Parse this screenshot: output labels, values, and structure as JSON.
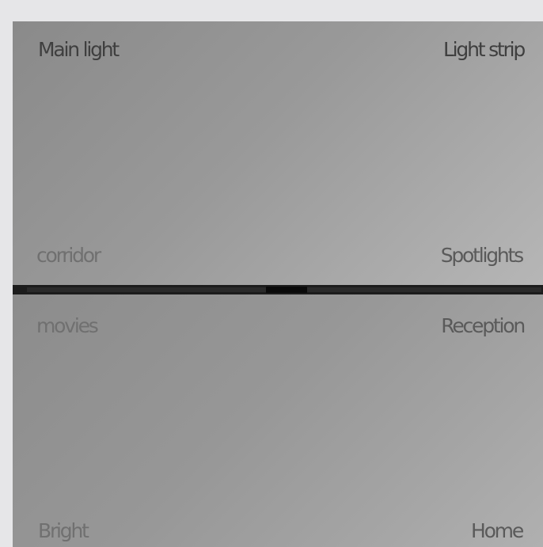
{
  "scenes": {
    "main_light": "Main light",
    "light_strip": "Light strip",
    "corridor": "corridor",
    "spotlights": "Spotlights",
    "movies": "movies",
    "reception": "Reception",
    "bright": "Bright",
    "home": "Home"
  },
  "colors": {
    "background": "#e6e6e8",
    "panel": "#8f8f8f",
    "divider": "#1c1c1c"
  }
}
